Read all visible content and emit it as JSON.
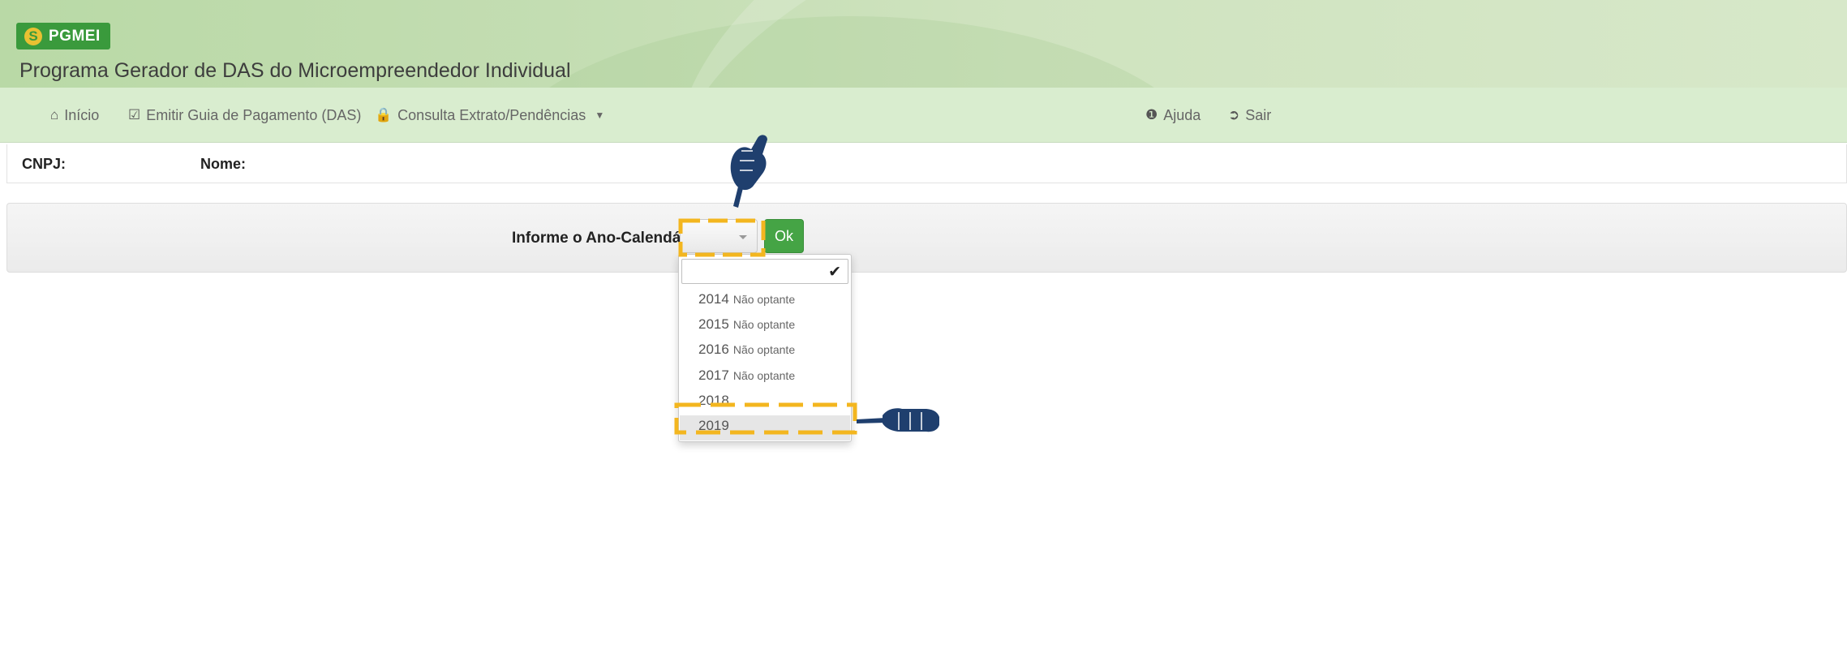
{
  "app": {
    "logo_text": "PGMEI",
    "logo_mark": "S",
    "subtitle": "Programa Gerador de DAS do Microempreendedor Individual"
  },
  "nav": {
    "items": [
      {
        "icon": "home-icon",
        "label": "Início"
      },
      {
        "icon": "check-square-icon",
        "label": "Emitir Guia de Pagamento (DAS)"
      },
      {
        "icon": "lock-icon",
        "label": "Consulta Extrato/Pendências"
      }
    ],
    "right": [
      {
        "icon": "info-circle-icon",
        "label": "Ajuda"
      },
      {
        "icon": "sign-out-icon",
        "label": "Sair"
      }
    ]
  },
  "info": {
    "cnpj_label": "CNPJ:",
    "nome_label": "Nome:"
  },
  "form": {
    "ano_label": "Informe o Ano-Calendário:",
    "ok_label": "Ok",
    "selected_value": ""
  },
  "dropdown": {
    "check": "✔",
    "options": [
      {
        "year": "2014",
        "note": "Não optante"
      },
      {
        "year": "2015",
        "note": "Não optante"
      },
      {
        "year": "2016",
        "note": "Não optante"
      },
      {
        "year": "2017",
        "note": "Não optante"
      },
      {
        "year": "2018",
        "note": ""
      },
      {
        "year": "2019",
        "note": ""
      }
    ]
  },
  "colors": {
    "header_green": "#c3ddb2",
    "navbar_green": "#d9edcf",
    "logo_green": "#3a9a3c",
    "ok_green": "#45a445",
    "highlight_orange": "#f3b61f",
    "pointer_blue": "#1f3f6e"
  }
}
